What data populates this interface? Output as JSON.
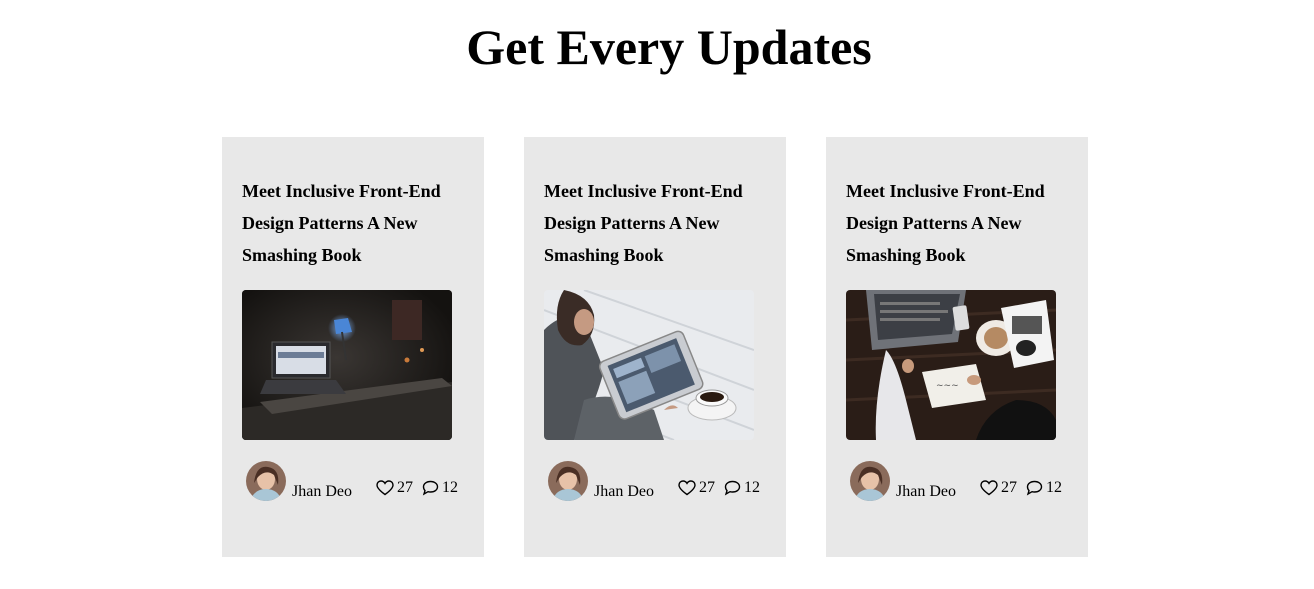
{
  "section": {
    "title": "Get Every Updates"
  },
  "cards": [
    {
      "title": "Meet Inclusive Front-End Design Patterns A New Smashing Book",
      "image": "laptop-desk-lamp-photo",
      "author": "Jhan Deo",
      "likes": "27",
      "comments": "12"
    },
    {
      "title": "Meet Inclusive Front-End Design Patterns A New Smashing Book",
      "image": "tablet-coffee-photo",
      "author": "Jhan Deo",
      "likes": "27",
      "comments": "12"
    },
    {
      "title": "Meet Inclusive Front-End Design Patterns A New Smashing Book",
      "image": "laptop-workspace-topdown-photo",
      "author": "Jhan Deo",
      "likes": "27",
      "comments": "12"
    }
  ],
  "colors": {
    "card_background": "#e8e8e8",
    "page_background": "#ffffff",
    "text": "#000000"
  },
  "icons": {
    "like": "heart-icon",
    "comment": "speech-bubble-icon"
  }
}
